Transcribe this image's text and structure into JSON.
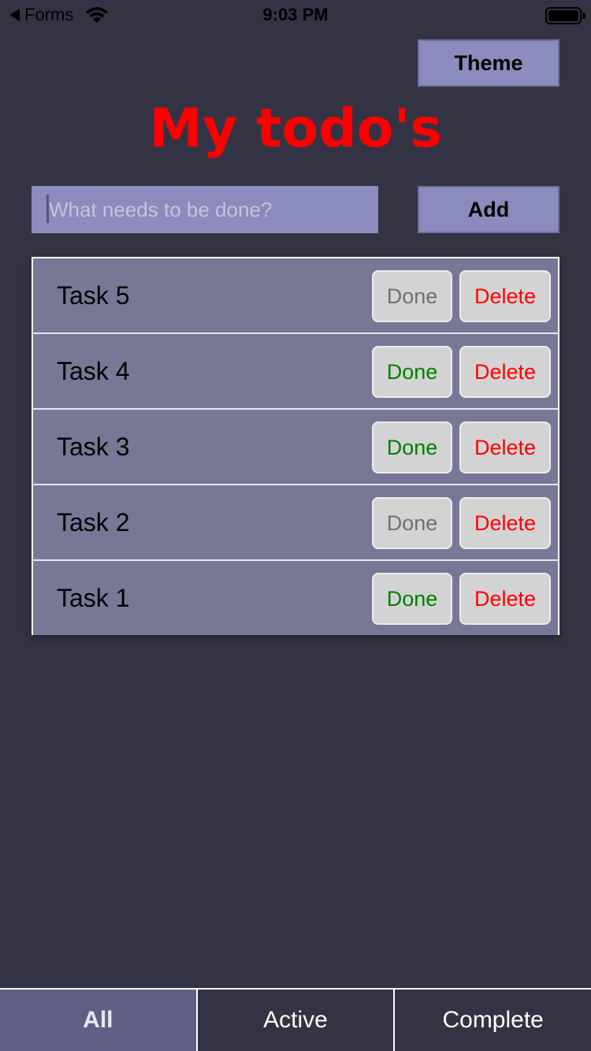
{
  "status_bar": {
    "back_label": "Forms",
    "time": "9:03 PM"
  },
  "header": {
    "theme_label": "Theme",
    "title": "My todo's"
  },
  "new_todo": {
    "placeholder": "What needs to be done?",
    "add_label": "Add"
  },
  "todos": [
    {
      "label": "Task 5",
      "done_label": "Done",
      "delete_label": "Delete",
      "done_state": "muted"
    },
    {
      "label": "Task 4",
      "done_label": "Done",
      "delete_label": "Delete",
      "done_state": "active"
    },
    {
      "label": "Task 3",
      "done_label": "Done",
      "delete_label": "Delete",
      "done_state": "active"
    },
    {
      "label": "Task 2",
      "done_label": "Done",
      "delete_label": "Delete",
      "done_state": "muted"
    },
    {
      "label": "Task 1",
      "done_label": "Done",
      "delete_label": "Delete",
      "done_state": "active"
    }
  ],
  "filters": {
    "tabs": [
      {
        "label": "All",
        "selected": true
      },
      {
        "label": "Active",
        "selected": false
      },
      {
        "label": "Complete",
        "selected": false
      }
    ]
  },
  "colors": {
    "background": "#343344",
    "accent": "#8b8bbd",
    "title": "#ff0000",
    "done_active": "#008000",
    "done_muted": "#707070",
    "delete": "#ff0000"
  }
}
